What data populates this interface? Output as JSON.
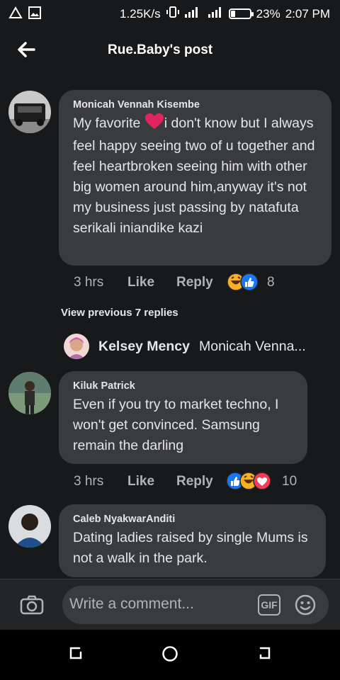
{
  "status_bar": {
    "net_speed": "1.25K/s",
    "battery": "23%",
    "battery_level": 0.23,
    "time": "2:07 PM"
  },
  "header": {
    "title": "Rue.Baby's post"
  },
  "comments": [
    {
      "author": "Monicah Vennah Kisembe",
      "text_before_emoji": "My favorite ",
      "emoji": "heart",
      "text_after_emoji": "i don't know but I always feel happy seeing two of u together and feel heartbroken seeing him with other big women around him,anyway it's not my business just passing by natafuta serikali iniandike kazi",
      "time": "3 hrs",
      "like": "Like",
      "reply": "Reply",
      "reactions": [
        "haha",
        "like"
      ],
      "reaction_count": "8"
    },
    {
      "author": "Kiluk Patrick",
      "text": "Even if you try to market techno, I won't get convinced. Samsung remain the darling",
      "time": "3 hrs",
      "like": "Like",
      "reply": "Reply",
      "reactions": [
        "like",
        "haha",
        "love"
      ],
      "reaction_count": "10"
    },
    {
      "author": "Caleb NyakwarAnditi",
      "text": "Dating ladies raised by single Mums is not a walk in the park."
    }
  ],
  "view_previous": "View previous 7 replies",
  "reply_preview": {
    "name": "Kelsey Mency",
    "text": "Monicah Venna..."
  },
  "composer": {
    "placeholder": "Write a comment...",
    "gif": "GIF"
  },
  "colors": {
    "background": "#18191a",
    "bubble": "#3a3b3c",
    "like_blue": "#1877f2",
    "love_red": "#f33e58",
    "haha_yellow": "#f7b125"
  }
}
